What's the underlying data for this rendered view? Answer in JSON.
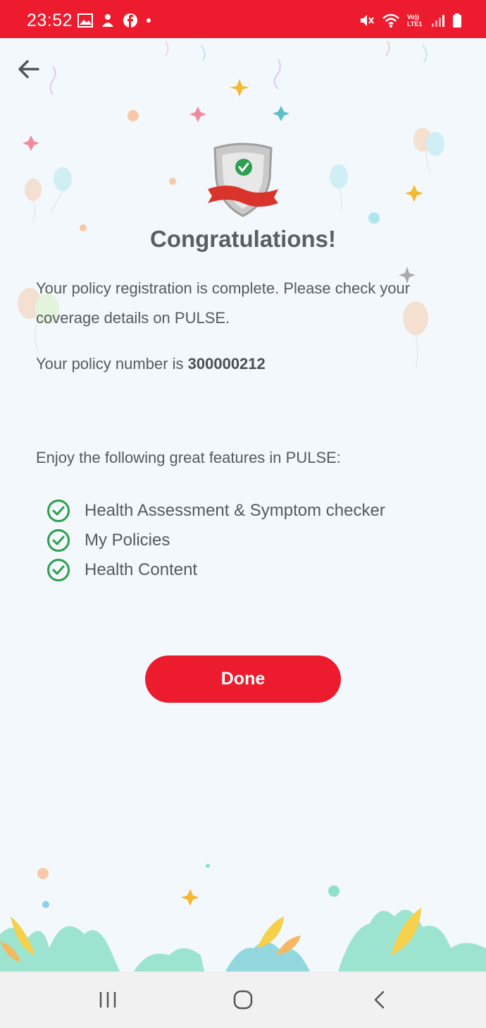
{
  "status_bar": {
    "time": "23:52",
    "left_icons": [
      "gallery-icon",
      "notification-app-icon",
      "facebook-icon",
      "dot-icon"
    ],
    "right_icons": [
      "mute-icon",
      "wifi-icon",
      "volte-lte-icon",
      "signal-icon",
      "battery-icon"
    ],
    "volte_label": "Vo)) LTE1",
    "color": "#ed1b2e"
  },
  "header": {
    "back_icon": "back-arrow-icon"
  },
  "main": {
    "badge_icon": "verified-shield-icon",
    "title": "Congratulations!",
    "message": "Your policy registration is complete. Please check your coverage details on PULSE.",
    "policy_prefix": "Your policy number is ",
    "policy_number": "300000212",
    "features_intro": "Enjoy the following great features in PULSE:",
    "features": [
      {
        "label": "Health Assessment & Symptom checker",
        "icon": "check-circle-icon"
      },
      {
        "label": "My Policies",
        "icon": "check-circle-icon"
      },
      {
        "label": "Health Content",
        "icon": "check-circle-icon"
      }
    ],
    "done_label": "Done",
    "accent_color": "#ed1b2e",
    "check_color": "#2e9e4f"
  },
  "nav_bar": {
    "buttons": [
      "recent-apps-icon",
      "home-icon",
      "back-icon"
    ]
  }
}
